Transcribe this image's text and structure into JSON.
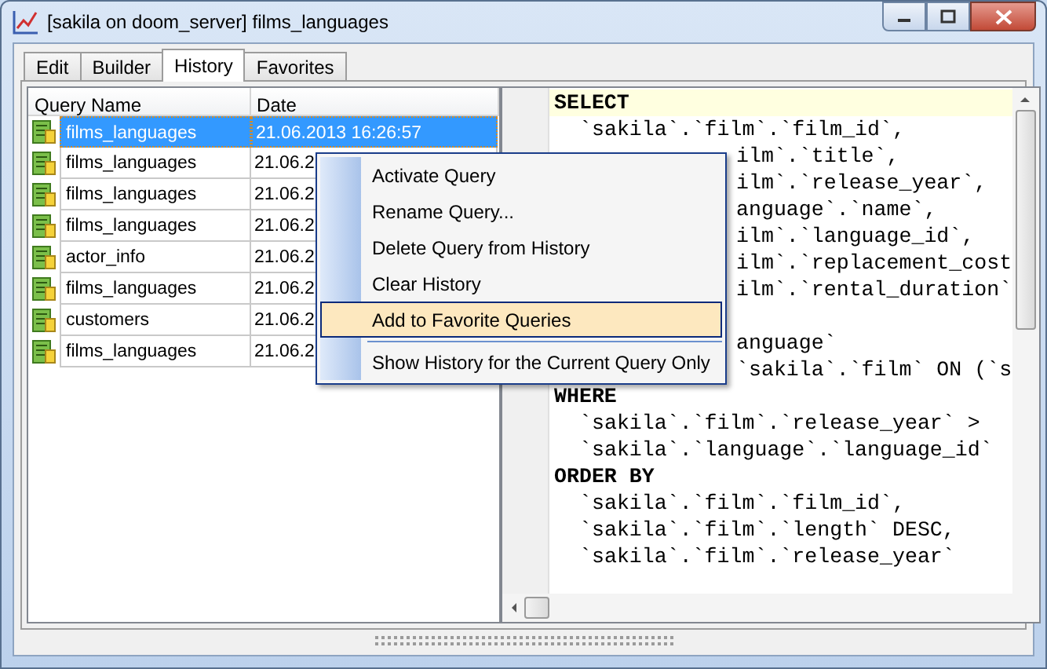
{
  "window": {
    "title": "[sakila on doom_server] films_languages"
  },
  "tabs": [
    {
      "label": "Edit",
      "selected": false
    },
    {
      "label": "Builder",
      "selected": false
    },
    {
      "label": "History",
      "selected": true
    },
    {
      "label": "Favorites",
      "selected": false
    }
  ],
  "history": {
    "columns": [
      "Query Name",
      "Date"
    ],
    "rows": [
      {
        "name": "films_languages",
        "date": "21.06.2013 16:26:57",
        "selected": true
      },
      {
        "name": "films_languages",
        "date": "21.06.2",
        "selected": false
      },
      {
        "name": "films_languages",
        "date": "21.06.2",
        "selected": false
      },
      {
        "name": "films_languages",
        "date": "21.06.2",
        "selected": false
      },
      {
        "name": "actor_info",
        "date": "21.06.2",
        "selected": false
      },
      {
        "name": "films_languages",
        "date": "21.06.2",
        "selected": false
      },
      {
        "name": "customers",
        "date": "21.06.2",
        "selected": false
      },
      {
        "name": "films_languages",
        "date": "21.06.2",
        "selected": false
      }
    ]
  },
  "editor": {
    "lines": [
      {
        "kind": "keyword",
        "text": "SELECT",
        "current": true
      },
      {
        "kind": "code",
        "text": "`sakila`.`film`.`film_id`,",
        "current": false
      },
      {
        "kind": "clipped",
        "text": "ilm`.`title`,",
        "current": false
      },
      {
        "kind": "clipped",
        "text": "ilm`.`release_year`,",
        "current": false
      },
      {
        "kind": "clipped",
        "text": "anguage`.`name`,",
        "current": false
      },
      {
        "kind": "clipped",
        "text": "ilm`.`language_id`,",
        "current": false
      },
      {
        "kind": "clipped",
        "text": "ilm`.`replacement_cost",
        "current": false
      },
      {
        "kind": "clipped",
        "text": "ilm`.`rental_duration`",
        "current": false
      },
      {
        "kind": "blank",
        "current": false
      },
      {
        "kind": "clipped",
        "text": "anguage`",
        "current": false
      },
      {
        "kind": "clipped",
        "text": "`sakila`.`film` ON (`s",
        "current": false
      },
      {
        "kind": "keyword",
        "text": "WHERE",
        "current": false
      },
      {
        "kind": "code",
        "text": "`sakila`.`film`.`release_year` >",
        "current": false
      },
      {
        "kind": "code",
        "text": "`sakila`.`language`.`language_id`",
        "current": false
      },
      {
        "kind": "keyword",
        "text": "ORDER BY",
        "current": false
      },
      {
        "kind": "code",
        "text": "`sakila`.`film`.`film_id`,",
        "current": false
      },
      {
        "kind": "code",
        "text": "`sakila`.`film`.`length` DESC,",
        "current": false
      },
      {
        "kind": "code",
        "text": "`sakila`.`film`.`release_year`",
        "current": false
      }
    ]
  },
  "context_menu": {
    "items": [
      {
        "label": "Activate Query",
        "selected": false,
        "separator_before": false
      },
      {
        "label": "Rename Query...",
        "selected": false,
        "separator_before": false
      },
      {
        "label": "Delete Query from History",
        "selected": false,
        "separator_before": false
      },
      {
        "label": "Clear History",
        "selected": false,
        "separator_before": false
      },
      {
        "label": "Add to Favorite Queries",
        "selected": true,
        "separator_before": false
      },
      {
        "label": "Show History for the Current Query Only",
        "selected": false,
        "separator_before": true
      }
    ]
  }
}
